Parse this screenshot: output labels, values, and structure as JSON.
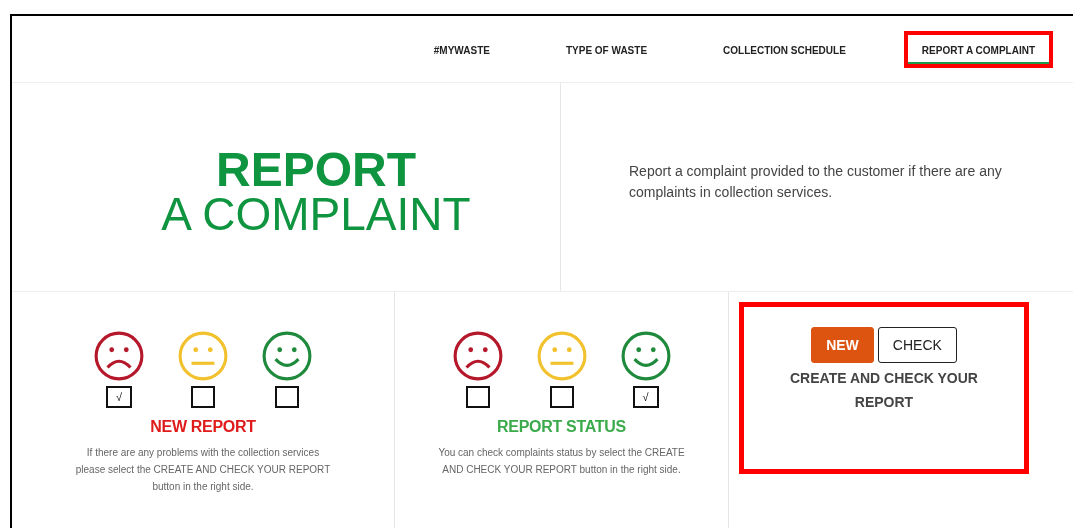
{
  "nav": {
    "items": [
      {
        "label": "#MYWASTE",
        "selected": false,
        "highlighted": false
      },
      {
        "label": "TYPE OF WASTE",
        "selected": false,
        "highlighted": false
      },
      {
        "label": "COLLECTION SCHEDULE",
        "selected": false,
        "highlighted": false
      },
      {
        "label": "REPORT A COMPLAINT",
        "selected": true,
        "highlighted": true
      }
    ]
  },
  "hero": {
    "title_line_1": "REPORT",
    "title_line_2": "A COMPLAINT",
    "description": "Report a complaint provided to the customer if there are any complaints in collection services."
  },
  "panels": [
    {
      "title": "NEW REPORT",
      "color": "#e01b1b",
      "check_mark": "√",
      "description": "If there are any problems with the collection services please select the CREATE AND CHECK YOUR REPORT button in the right side.",
      "faces": [
        {
          "kind": "sad",
          "color": "#b5182b",
          "checked": true
        },
        {
          "kind": "neutral",
          "color": "#f2c12e",
          "checked": false
        },
        {
          "kind": "happy",
          "color": "#1f8a3c",
          "checked": false
        }
      ]
    },
    {
      "title": "REPORT STATUS",
      "color": "#3aaa4a",
      "check_mark": "√",
      "description": "You can check complaints status by select the CREATE AND CHECK YOUR REPORT button in the right side.",
      "faces": [
        {
          "kind": "sad",
          "color": "#b5182b",
          "checked": false
        },
        {
          "kind": "neutral",
          "color": "#f2c12e",
          "checked": false
        },
        {
          "kind": "happy",
          "color": "#1f8a3c",
          "checked": true
        }
      ]
    }
  ],
  "actions": {
    "highlighted": true,
    "buttons": [
      {
        "label": "NEW",
        "selected": true
      },
      {
        "label": "CHECK",
        "selected": false
      }
    ],
    "caption": "CREATE AND CHECK YOUR REPORT"
  }
}
